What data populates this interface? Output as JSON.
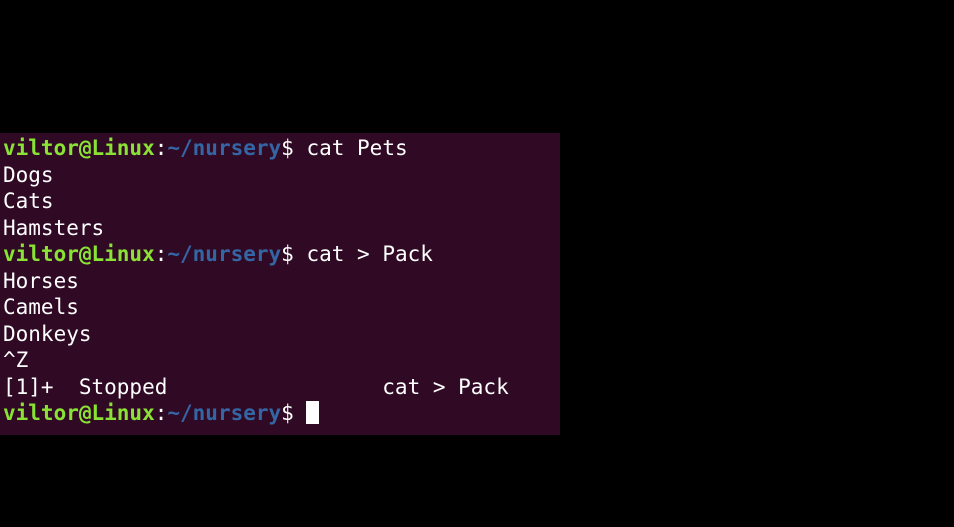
{
  "prompt": {
    "user_host": "viltor@Linux",
    "colon": ":",
    "path": "~/nursery",
    "dollar": "$ "
  },
  "lines": [
    {
      "type": "prompt",
      "command": "cat Pets"
    },
    {
      "type": "output",
      "text": "Dogs"
    },
    {
      "type": "output",
      "text": "Cats"
    },
    {
      "type": "output",
      "text": "Hamsters"
    },
    {
      "type": "prompt",
      "command": "cat > Pack"
    },
    {
      "type": "output",
      "text": "Horses"
    },
    {
      "type": "output",
      "text": "Camels"
    },
    {
      "type": "output",
      "text": "Donkeys"
    },
    {
      "type": "output",
      "text": "^Z"
    },
    {
      "type": "output",
      "text": "[1]+  Stopped                 cat > Pack"
    },
    {
      "type": "prompt",
      "command": "",
      "cursor": true
    }
  ],
  "colors": {
    "terminal_bg": "#300a24",
    "user_host": "#8ae234",
    "path": "#3465a4",
    "text": "#ffffff",
    "outer_bg": "#000000"
  }
}
